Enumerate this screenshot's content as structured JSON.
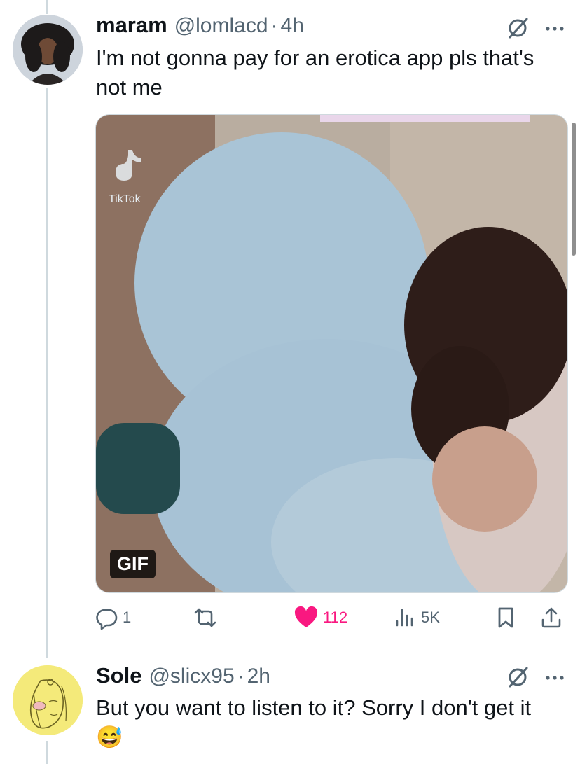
{
  "tweets": [
    {
      "name": "maram",
      "handle": "@lomlacd",
      "sep": "·",
      "time": "4h",
      "text": "I'm not gonna pay for an erotica app pls that's not me",
      "media": {
        "badge": "GIF"
      },
      "actions": {
        "replies": "1",
        "retweets": "",
        "likes": "112",
        "views": "5K"
      }
    },
    {
      "name": "Sole",
      "handle": "@slicx95",
      "sep": "·",
      "time": "2h",
      "text": "But you want to listen to it? Sorry I don't get it",
      "emoji": "😅"
    }
  ],
  "colors": {
    "like": "#f91880",
    "muted": "#536471",
    "thread_line": "#cfd9de"
  },
  "icons": [
    "grok-icon",
    "more-icon",
    "reply-icon",
    "retweet-icon",
    "heart-icon",
    "views-icon",
    "bookmark-icon",
    "share-icon"
  ]
}
